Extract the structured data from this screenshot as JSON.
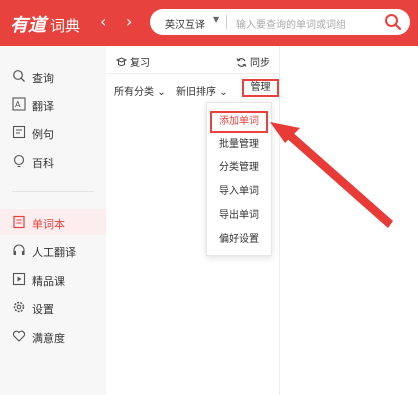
{
  "header": {
    "logo_text": "有道",
    "logo_sub": "词典",
    "back_glyph": "‹",
    "forward_glyph": "›",
    "search": {
      "language": "英汉互译",
      "placeholder": "输入要查询的单词或词组"
    }
  },
  "sidebar": {
    "items": [
      {
        "label": "查询",
        "icon": "search-icon"
      },
      {
        "label": "翻译",
        "icon": "translate-icon"
      },
      {
        "label": "例句",
        "icon": "sentence-icon"
      },
      {
        "label": "百科",
        "icon": "bulb-icon"
      },
      {
        "label": "单词本",
        "icon": "wordbook-icon",
        "active": true
      },
      {
        "label": "人工翻译",
        "icon": "headset-icon"
      },
      {
        "label": "精品课",
        "icon": "course-icon"
      },
      {
        "label": "设置",
        "icon": "gear-icon"
      },
      {
        "label": "满意度",
        "icon": "heart-icon"
      }
    ]
  },
  "toolbar": {
    "review_label": "复习",
    "sync_label": "同步",
    "category_filter": "所有分类",
    "sort_filter": "新旧排序",
    "manage_label": "管理"
  },
  "manage_menu": {
    "items": [
      "添加单词",
      "批量管理",
      "分类管理",
      "导入单词",
      "导出单词",
      "偏好设置"
    ],
    "highlighted": "添加单词"
  },
  "colors": {
    "brand": "#e8423f",
    "sidebar_bg": "#f7f7f7",
    "active_bg": "#fceeee"
  }
}
